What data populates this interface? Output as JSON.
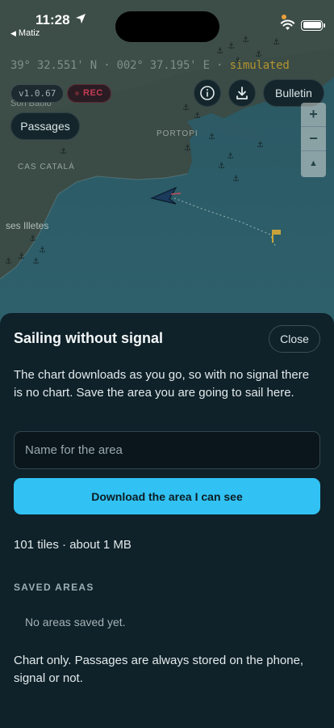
{
  "status_bar": {
    "time": "11:28",
    "back_app": "Matiz"
  },
  "map": {
    "coordinates_text": "39° 32.551' N · 002° 37.195' E · ",
    "simulated_label": "simulated",
    "place_labels": [
      "PORTOPI",
      "CAS CATALÀ",
      "ses Illetes",
      "Son Bauló"
    ],
    "version_chip": "v1.0.67",
    "rec_chip": "REC",
    "bulletin_label": "Bulletin",
    "passages_label": "Passages",
    "zoom_in": "+",
    "zoom_out": "−",
    "compass": "▲",
    "colors": {
      "sea": "#2c5c68",
      "land": "#3d4d47",
      "simulated": "#b39530",
      "vessel": "#1b3a5c"
    }
  },
  "sheet": {
    "title": "Sailing without signal",
    "close_label": "Close",
    "description": "The chart downloads as you go, so with no signal there is no chart. Save the area you are going to sail here.",
    "name_placeholder": "Name for the area",
    "download_label": "Download the area I can see",
    "tiles_info": "101 tiles · about 1 MB",
    "saved_heading": "SAVED AREAS",
    "empty_message": "No areas saved yet.",
    "footer_note": "Chart only. Passages are always stored on the phone, signal or not.",
    "accent_color": "#31c2f3"
  }
}
